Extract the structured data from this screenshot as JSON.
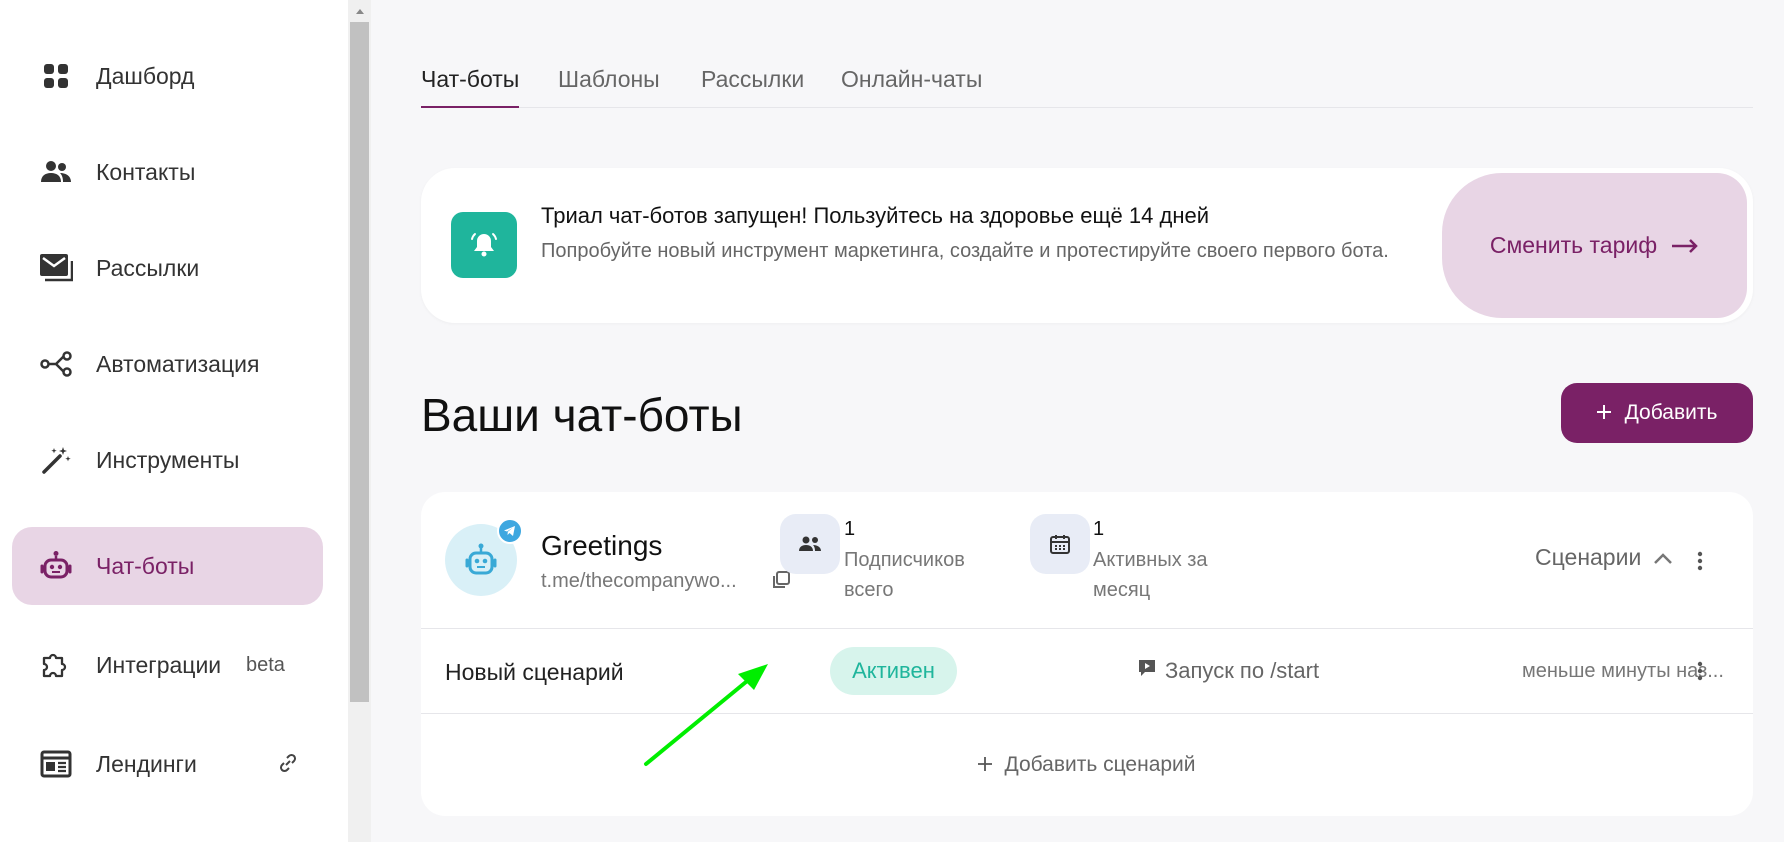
{
  "sidebar": {
    "items": [
      {
        "label": "Дашборд",
        "icon": "dashboard-icon"
      },
      {
        "label": "Контакты",
        "icon": "contacts-icon"
      },
      {
        "label": "Рассылки",
        "icon": "mailings-icon"
      },
      {
        "label": "Автоматизация",
        "icon": "automation-icon"
      },
      {
        "label": "Инструменты",
        "icon": "magic-wand-icon"
      },
      {
        "label": "Чат-боты",
        "icon": "robot-icon",
        "active": true
      },
      {
        "label": "Интеграции",
        "icon": "puzzle-icon",
        "extra": "beta"
      },
      {
        "label": "Лендинги",
        "icon": "landing-icon",
        "extra_icon": "link-icon"
      }
    ]
  },
  "tabs": [
    {
      "label": "Чат-боты",
      "active": true
    },
    {
      "label": "Шаблоны"
    },
    {
      "label": "Рассылки"
    },
    {
      "label": "Онлайн-чаты"
    }
  ],
  "banner": {
    "icon": "bell-icon",
    "title": "Триал чат-ботов запущен! Пользуйтесь на здоровье ещё 14 дней",
    "subtitle": "Попробуйте новый инструмент маркетинга, создайте и протестируйте своего первого бота.",
    "button_label": "Сменить тариф",
    "button_icon": "arrow-right-icon"
  },
  "section": {
    "title": "Ваши чат-боты",
    "add_button": "Добавить"
  },
  "bot": {
    "name": "Greetings",
    "link": "t.me/thecompanywo...",
    "stats": [
      {
        "value": "1",
        "label": "Подписчиков всего",
        "icon": "users-icon"
      },
      {
        "value": "1",
        "label": "Активных за месяц",
        "icon": "calendar-icon"
      }
    ],
    "scenarios_label": "Сценарии",
    "scenario": {
      "name": "Новый сценарий",
      "status": "Активен",
      "trigger": "Запуск по /start",
      "time": "меньше минуты наз..."
    },
    "add_scenario": "Добавить сценарий"
  },
  "colors": {
    "accent": "#7a2166",
    "accent_light": "#e8d5e5",
    "teal": "#1fb59c",
    "arrow": "#00ee00"
  }
}
